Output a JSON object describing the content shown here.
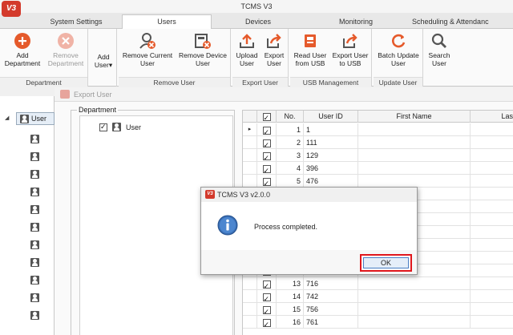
{
  "app": {
    "title": "TCMS V3",
    "logo_text": "V3"
  },
  "tabs": [
    {
      "label": "System Settings",
      "active": false
    },
    {
      "label": "Users",
      "active": true
    },
    {
      "label": "Devices",
      "active": false
    },
    {
      "label": "Monitoring",
      "active": false
    },
    {
      "label": "Scheduling & Attendanc",
      "active": false
    }
  ],
  "ribbon": {
    "department": {
      "label": "Department",
      "add": "Add\nDepartment",
      "remove": "Remove\nDepartment"
    },
    "add_user": {
      "label": "Add\nUser▾"
    },
    "remove_user": {
      "label": "Remove User",
      "remove_current": "Remove Current\nUser",
      "remove_device": "Remove Device\nUser"
    },
    "export_user": {
      "label": "Export User",
      "upload": "Upload\nUser",
      "export": "Export\nUser"
    },
    "usb": {
      "label": "USB Management",
      "read": "Read User\nfrom USB",
      "export": "Export User\nto USB"
    },
    "update": {
      "label": "Update User",
      "batch": "Batch Update\nUser"
    },
    "search": {
      "label": "Search\nUser"
    }
  },
  "tree": {
    "root_label": "User"
  },
  "export_window": {
    "title": "Export User",
    "department_legend": "Department",
    "department_item": "User"
  },
  "grid": {
    "headers": {
      "no": "No.",
      "user_id": "User ID",
      "first_name": "First Name",
      "last": "Las"
    },
    "rows": [
      {
        "no": "1",
        "user_id": "1"
      },
      {
        "no": "2",
        "user_id": "111"
      },
      {
        "no": "3",
        "user_id": "129"
      },
      {
        "no": "4",
        "user_id": "396"
      },
      {
        "no": "5",
        "user_id": "476"
      },
      {
        "no": "13",
        "user_id": "716"
      },
      {
        "no": "14",
        "user_id": "742"
      },
      {
        "no": "15",
        "user_id": "756"
      },
      {
        "no": "16",
        "user_id": "761"
      }
    ]
  },
  "dialog": {
    "title": "TCMS V3 v2.0.0",
    "message": "Process completed.",
    "ok_label": "OK"
  },
  "colors": {
    "accent_red": "#e0161c",
    "brand_red": "#d33a2c",
    "icon_blue": "#3a6fb5",
    "icon_orange": "#e55a2b"
  }
}
